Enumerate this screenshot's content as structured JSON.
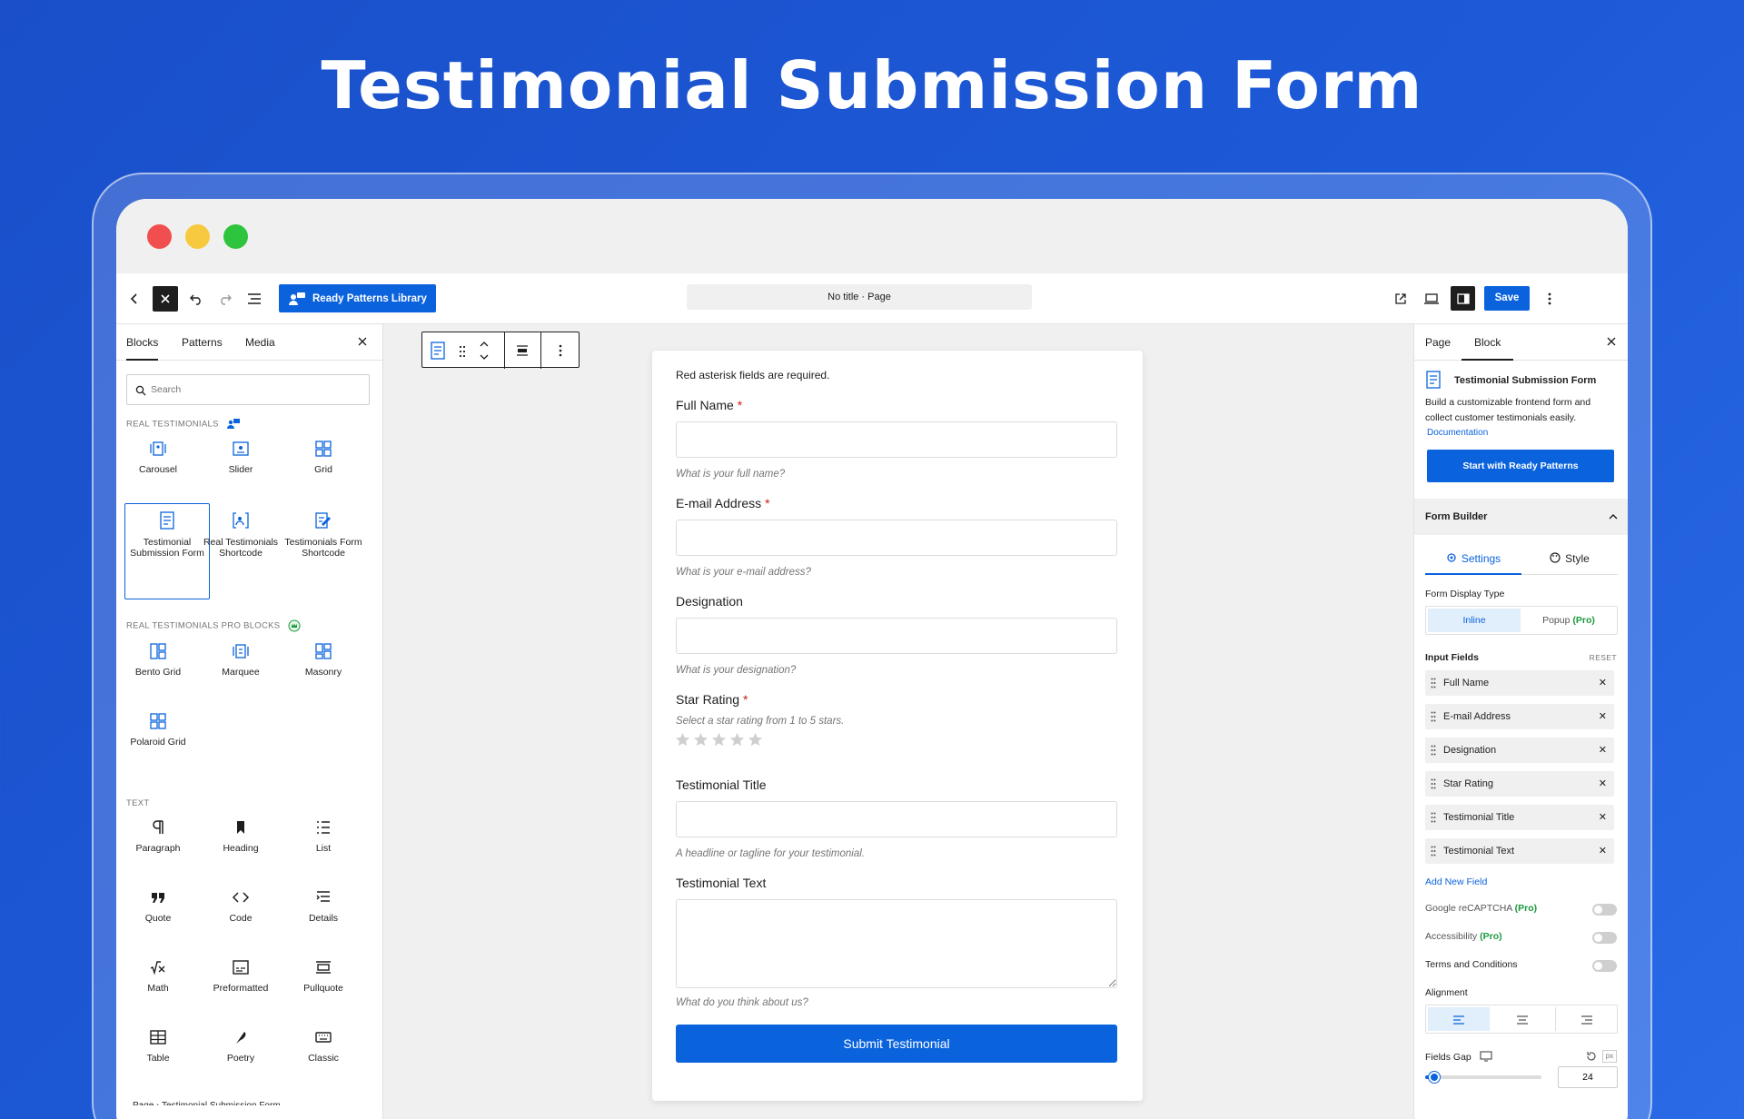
{
  "hero_title": "Testimonial Submission Form",
  "topbar": {
    "library_label": "Ready Patterns Library",
    "doc_title": "No title · Page",
    "save_label": "Save"
  },
  "left": {
    "tabs": [
      "Blocks",
      "Patterns",
      "Media"
    ],
    "search_placeholder": "Search",
    "section1": "REAL TESTIMONIALS",
    "blocks1": [
      "Carousel",
      "Slider",
      "Grid",
      "Testimonial Submission Form",
      "Real Testimonials Shortcode",
      "Testimonials Form Shortcode"
    ],
    "section2": "REAL TESTIMONIALS PRO BLOCKS",
    "blocks2": [
      "Bento Grid",
      "Marquee",
      "Masonry",
      "Polaroid Grid"
    ],
    "section3": "TEXT",
    "blocks3": [
      "Paragraph",
      "Heading",
      "List",
      "Quote",
      "Code",
      "Details",
      "Math",
      "Preformatted",
      "Pullquote",
      "Table",
      "Poetry",
      "Classic"
    ],
    "breadcrumb": "Page › Testimonial Submission Form"
  },
  "form": {
    "required_note": "Red asterisk fields are required.",
    "full_name_label": "Full Name",
    "full_name_hint": "What is your full name?",
    "email_label": "E-mail Address",
    "email_hint": "What is your e-mail address?",
    "designation_label": "Designation",
    "designation_hint": "What is your designation?",
    "star_label": "Star Rating",
    "star_hint": "Select a star rating from 1 to 5 stars.",
    "title_label": "Testimonial Title",
    "title_hint": "A headline or tagline for your testimonial.",
    "text_label": "Testimonial Text",
    "text_hint": "What do you think about us?",
    "submit_label": "Submit Testimonial"
  },
  "right": {
    "tabs": [
      "Page",
      "Block"
    ],
    "block_title": "Testimonial Submission Form",
    "block_desc": "Build a customizable frontend form and collect customer testimonials easily.",
    "doc_link": "Documentation",
    "start_button": "Start with Ready Patterns",
    "form_builder": "Form Builder",
    "settings_tab": "Settings",
    "style_tab": "Style",
    "display_type_label": "Form Display Type",
    "inline_label": "Inline",
    "popup_label": "Popup",
    "pro_label": "(Pro)",
    "input_fields_label": "Input Fields",
    "reset_label": "RESET",
    "fields": [
      "Full Name",
      "E-mail Address",
      "Designation",
      "Star Rating",
      "Testimonial Title",
      "Testimonial Text"
    ],
    "add_field": "Add New Field",
    "recaptcha": "Google reCAPTCHA",
    "accessibility": "Accessibility",
    "terms": "Terms and Conditions",
    "alignment_label": "Alignment",
    "fields_gap_label": "Fields Gap",
    "fields_gap_unit": "px",
    "fields_gap_value": "24",
    "fields_gap_fraction": 0.06
  },
  "colors": {
    "accent": "#0a63dd",
    "bg": "#1d56d4"
  }
}
